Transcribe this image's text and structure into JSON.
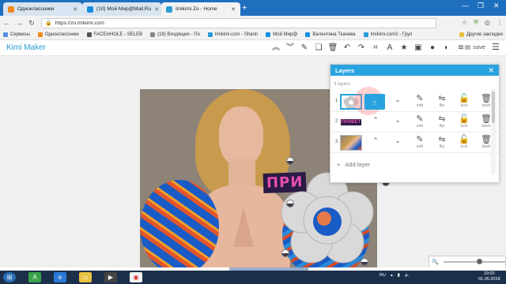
{
  "browser": {
    "tabs": [
      {
        "label": "Одноклассники",
        "icon": "odnoklassniki-icon",
        "color": "#f08a1c",
        "active": false
      },
      {
        "label": "(10) Мой Мир@Mail.Ru",
        "icon": "mailru-icon",
        "color": "#168de2",
        "active": false
      },
      {
        "label": "Imikimi Zo - Home",
        "icon": "imikimi-icon",
        "color": "#2a9bd8",
        "active": true
      }
    ],
    "address": {
      "url": "https://zo.imikimi.com"
    },
    "bookmarks": [
      {
        "label": "Сервисы",
        "color": "#5a8ee0"
      },
      {
        "label": "Одноклассники",
        "color": "#f08a1c"
      },
      {
        "label": "FACEinHOLE - SELEB",
        "color": "#555555"
      },
      {
        "label": "(18) Входящие - По",
        "color": "#888888"
      },
      {
        "label": "Imikimi.com - Sharin",
        "color": "#2a9bd8"
      },
      {
        "label": "Мой Мир@",
        "color": "#168de2"
      },
      {
        "label": "Валентина Ткачева",
        "color": "#168de2"
      },
      {
        "label": "Imikimi.com2 - Груп",
        "color": "#2a9bd8"
      }
    ],
    "bookmarks_right": "Другие закладки"
  },
  "app": {
    "logo": "Kimi Maker",
    "save_label": "save",
    "sticker_text": "ПРИ",
    "zoom_level": 0.6
  },
  "layers_panel": {
    "title": "Layers",
    "count_label": "3 layers",
    "rows": [
      {
        "num": "1",
        "thumb_type": "flower",
        "selected": true,
        "actions": [
          "edit",
          "flip",
          "lock",
          "trash"
        ]
      },
      {
        "num": "2",
        "thumb_type": "text",
        "thumb_text": "ПРИВЕТ",
        "selected": false,
        "actions": [
          "edit",
          "flip",
          "lock",
          "trash"
        ]
      },
      {
        "num": "3",
        "thumb_type": "photo",
        "selected": false,
        "actions": [
          "edit",
          "flip",
          "lock",
          "trash"
        ]
      }
    ],
    "add_label": "Add layer"
  },
  "taskbar": {
    "lang": "RU",
    "time": "19:02",
    "date": "01.05.2018"
  }
}
